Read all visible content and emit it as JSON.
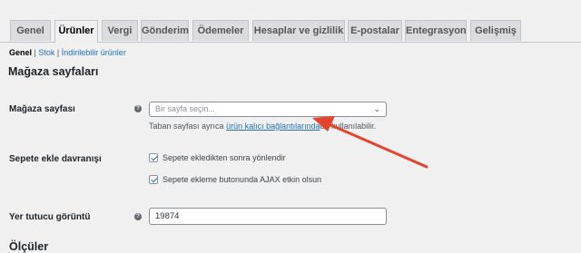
{
  "tabs": [
    {
      "label": "Genel"
    },
    {
      "label": "Ürünler"
    },
    {
      "label": "Vergi"
    },
    {
      "label": "Gönderim"
    },
    {
      "label": "Ödemeler"
    },
    {
      "label": "Hesaplar ve gizlilik"
    },
    {
      "label": "E-postalar"
    },
    {
      "label": "Entegrasyon"
    },
    {
      "label": "Gelişmiş"
    }
  ],
  "active_tab": "Ürünler",
  "subnav": {
    "general": "Genel",
    "separator": "|",
    "stock": "Stok",
    "downloadable": "İndirilebilir ürünler"
  },
  "section_title": "Mağaza sayfaları",
  "shop_page": {
    "label": "Mağaza sayfası",
    "help_icon": "help-icon",
    "placeholder": "Bir sayfa seçin...",
    "desc_before": "Taban sayfası ayrıca",
    "desc_link": "ürün kalıcı bağlantılarında",
    "desc_after": "da kullanılabilir."
  },
  "add_to_cart": {
    "label": "Sepete ekle davranışı",
    "option1": "Sepete ekledikten sonra yönlendir",
    "option1_checked": true,
    "option2": "Sepete ekleme butonunda AJAX etkin olsun",
    "option2_checked": true
  },
  "placeholder_image": {
    "label": "Yer tutucu görüntü",
    "value": "19874"
  },
  "measurements_title": "Ölçüler",
  "colors": {
    "link": "#2271b1",
    "arrow": "#e4442c"
  }
}
